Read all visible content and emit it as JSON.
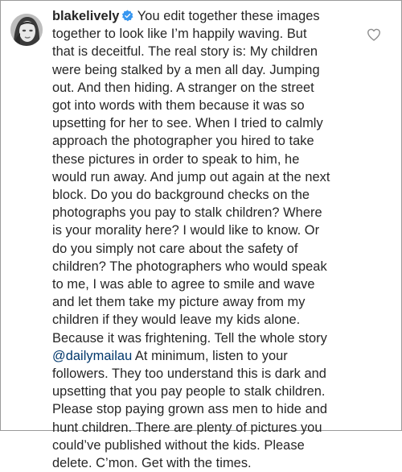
{
  "comment": {
    "username": "blakelively",
    "verified": true,
    "text_before_mention": "You edit together these images\ntogether to look like I’m happily waving. But\nthat is deceitful. The real story is: My children\nwere being stalked by a men all day. Jumping\nout. And then hiding. A stranger on the street\ngot into words with them because it was so\nupsetting for her to see. When I tried to calmly\napproach the photographer you hired to take\nthese pictures in order to speak to him, he\nwould run away. And jump out again at the next\nblock. Do you do background checks on the\nphotographs you pay to stalk children? Where\nis your morality here? I would like to know. Or\ndo you simply not care about the safety of\nchildren? The photographers who would speak\nto me, I was able to agree to smile and wave\nand let them take my picture away from my\nchildren if they would leave my kids alone.\nBecause it was frightening. Tell the whole story\n",
    "mention": "@dailymailau",
    "text_after_mention": " At minimum, listen to your\nfollowers. They too understand this is dark and\nupsetting that you pay people to stalk children.\nPlease stop paying grown ass men to hide and\nhunt children. There are plenty of pictures you\ncould’ve published without the kids. Please\ndelete. C’mon. Get with the times."
  },
  "icons": {
    "avatar": "profile-photo",
    "verified": "verified-badge-icon",
    "like": "heart-outline-icon"
  },
  "colors": {
    "text": "#262626",
    "verified_badge": "#3897f0",
    "mention": "#00376b",
    "heart": "#8e8e8e"
  }
}
